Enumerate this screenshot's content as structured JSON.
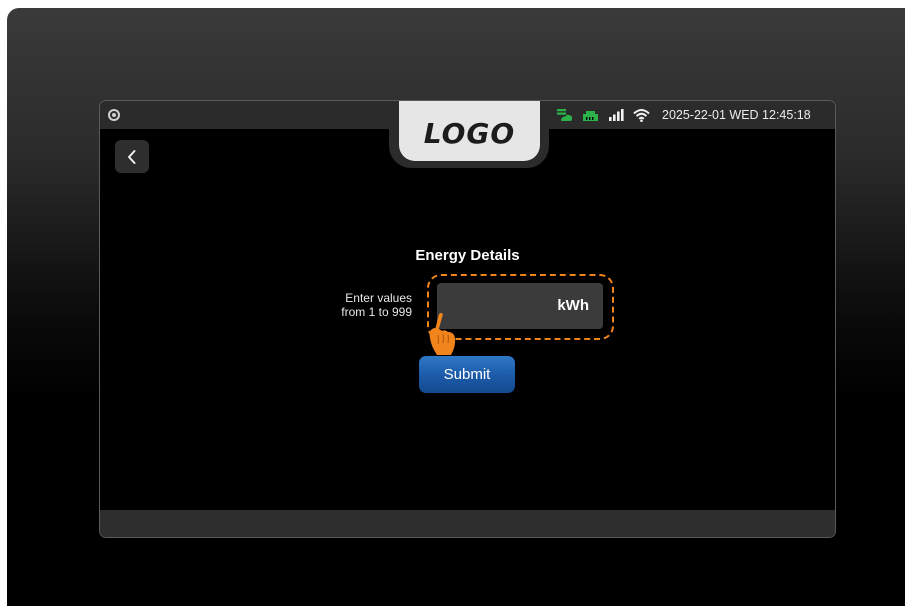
{
  "status_bar": {
    "icons": [
      "cloud-sync-icon",
      "ethernet-icon",
      "signal-bars-icon",
      "wifi-icon"
    ],
    "datetime": "2025-22-01 WED 12:45:18"
  },
  "logo": {
    "text": "LOGO"
  },
  "page": {
    "title": "Energy Details",
    "hint_line1": "Enter values",
    "hint_line2": "from 1 to 999",
    "input": {
      "value": "",
      "placeholder": "",
      "unit": "kWh"
    },
    "submit_label": "Submit"
  },
  "colors": {
    "accent_orange": "#f2841c",
    "submit_blue": "#1c5aa8",
    "status_green": "#2bb34a"
  }
}
